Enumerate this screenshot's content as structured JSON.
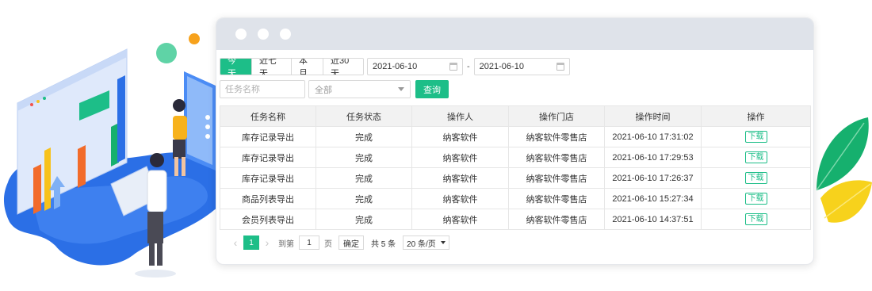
{
  "filters": {
    "range_tabs": [
      {
        "label": "今天",
        "active": true
      },
      {
        "label": "近七天",
        "active": false
      },
      {
        "label": "本月",
        "active": false
      },
      {
        "label": "近30天",
        "active": false
      }
    ],
    "start_date": "2021-06-10",
    "date_separator": "-",
    "end_date": "2021-06-10",
    "task_name_placeholder": "任务名称",
    "status_select": "全部",
    "query_label": "查询"
  },
  "table": {
    "columns": [
      "任务名称",
      "任务状态",
      "操作人",
      "操作门店",
      "操作时间",
      "操作"
    ],
    "rows": [
      [
        "库存记录导出",
        "完成",
        "纳客软件",
        "纳客软件零售店",
        "2021-06-10 17:31:02",
        "下载"
      ],
      [
        "库存记录导出",
        "完成",
        "纳客软件",
        "纳客软件零售店",
        "2021-06-10 17:29:53",
        "下载"
      ],
      [
        "库存记录导出",
        "完成",
        "纳客软件",
        "纳客软件零售店",
        "2021-06-10 17:26:37",
        "下载"
      ],
      [
        "商品列表导出",
        "完成",
        "纳客软件",
        "纳客软件零售店",
        "2021-06-10 15:27:34",
        "下载"
      ],
      [
        "会员列表导出",
        "完成",
        "纳客软件",
        "纳客软件零售店",
        "2021-06-10 14:37:51",
        "下载"
      ]
    ]
  },
  "pager": {
    "prev": "‹",
    "current": "1",
    "next": "›",
    "goto_label": "到第",
    "goto_value": "1",
    "page_unit": "页",
    "confirm_label": "确定",
    "total_label": "共 5 条",
    "page_size": "20 条/页"
  },
  "colors": {
    "accent": "#1dbe88",
    "titlebar": "#dfe3ea",
    "illustration_blue": "#2b6fe6",
    "leaf_green": "#16b06e",
    "leaf_yellow": "#f7d21c"
  },
  "icons": [
    "calendar-icon",
    "dropdown-arrow-icon",
    "prev-page-icon",
    "next-page-icon"
  ]
}
